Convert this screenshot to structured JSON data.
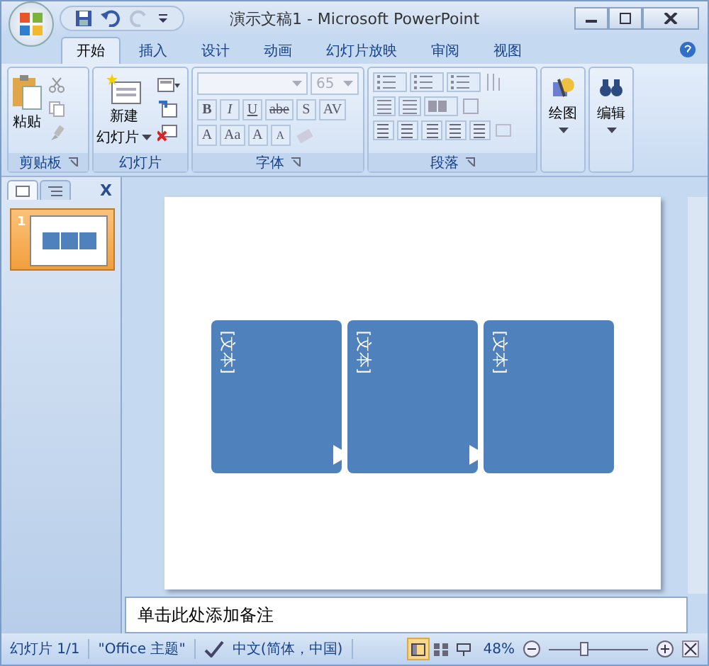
{
  "window": {
    "title": "演示文稿1 - Microsoft PowerPoint"
  },
  "tabs": [
    {
      "label": "开始",
      "selected": true
    },
    {
      "label": "插入",
      "selected": false
    },
    {
      "label": "设计",
      "selected": false
    },
    {
      "label": "动画",
      "selected": false
    },
    {
      "label": "幻灯片放映",
      "selected": false
    },
    {
      "label": "审阅",
      "selected": false
    },
    {
      "label": "视图",
      "selected": false
    }
  ],
  "ribbon": {
    "clipboard": {
      "label": "剪贴板",
      "paste": "粘贴"
    },
    "slides": {
      "label": "幻灯片",
      "new_slide_line1": "新建",
      "new_slide_line2": "幻灯片"
    },
    "font": {
      "label": "字体",
      "size": "65",
      "format_buttons": [
        "B",
        "I",
        "U",
        "abe",
        "S",
        "AV"
      ],
      "size_buttons": [
        "A",
        "Aa",
        "A",
        "A"
      ]
    },
    "paragraph": {
      "label": "段落"
    },
    "drawing": {
      "label": "绘图"
    },
    "editing": {
      "label": "编辑"
    }
  },
  "panel": {
    "tabs": [
      {
        "kind": "slides",
        "selected": true
      },
      {
        "kind": "outline",
        "selected": false
      }
    ],
    "close": "X",
    "thumbnails": [
      {
        "number": "1",
        "selected": true
      }
    ]
  },
  "slide": {
    "shapes": [
      {
        "text": "[文本]",
        "arrow": true
      },
      {
        "text": "[文本]",
        "arrow": true
      },
      {
        "text": "[文本]",
        "arrow": false
      }
    ]
  },
  "notes": {
    "placeholder": "单击此处添加备注"
  },
  "status_bar": {
    "slide": "幻灯片 1/1",
    "theme": "\"Office 主题\"",
    "language": "中文(简体，中国)",
    "views": [
      {
        "kind": "normal",
        "selected": true
      },
      {
        "kind": "sorter",
        "selected": false
      },
      {
        "kind": "show",
        "selected": false
      }
    ],
    "zoom": "48%",
    "zoom_level": {
      "level": 0.35
    }
  }
}
